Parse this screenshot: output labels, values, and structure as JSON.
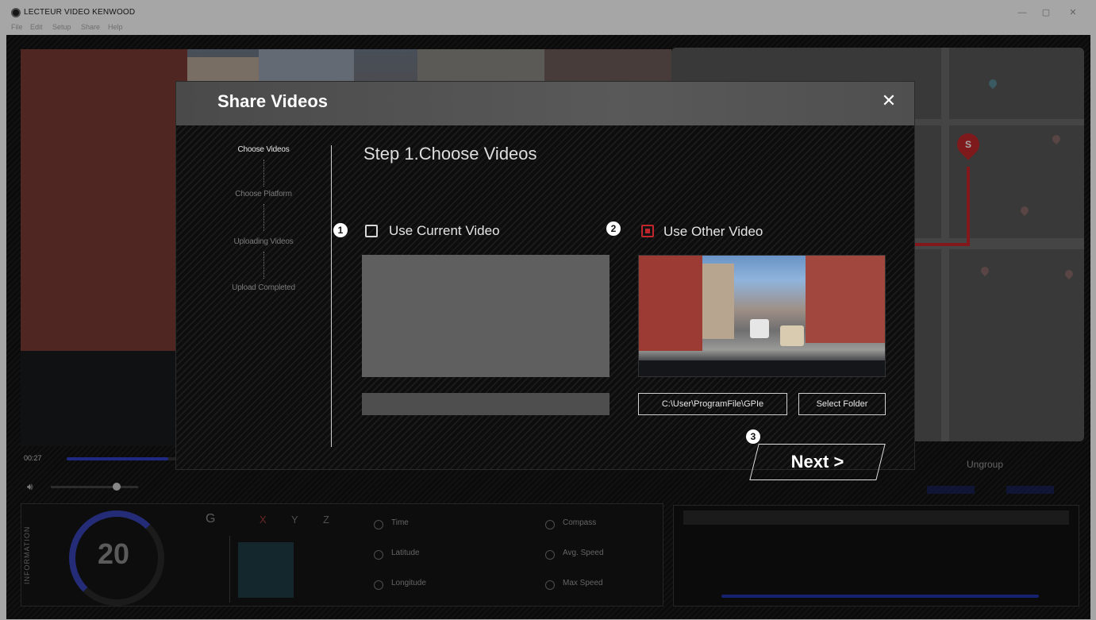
{
  "window": {
    "title": "LECTEUR VIDEO KENWOOD",
    "menu": [
      "File",
      "Edit",
      "Setup",
      "Share",
      "Help"
    ],
    "controls": {
      "minimize": "—",
      "maximize": "▢",
      "close": "✕"
    }
  },
  "player": {
    "time": "00:27",
    "progress": 0.85,
    "volume": 0.75,
    "ungroup_label": "Ungroup"
  },
  "info": {
    "panel_label": "INFORMATION",
    "speed": "20",
    "g_label": "G",
    "axes": [
      "X",
      "Y",
      "Z"
    ],
    "fields": {
      "time": "Time",
      "latitude": "Latitude",
      "longitude": "Longitude",
      "compass": "Compass",
      "avg_speed": "Avg. Speed",
      "max_speed": "Max Speed"
    }
  },
  "map": {
    "marker_label": "S"
  },
  "dialog": {
    "title": "Share Videos",
    "steps": [
      "Choose Videos",
      "Choose Platform",
      "Uploading Videos",
      "Upload Completed"
    ],
    "active_step": 0,
    "step_heading": "Step 1.Choose Videos",
    "option1": {
      "badge": "1",
      "label": "Use Current Video",
      "checked": false
    },
    "option2": {
      "badge": "2",
      "label": "Use Other Video",
      "checked": true
    },
    "path_value": "C:\\User\\ProgramFile\\GPIe",
    "select_folder": "Select Folder",
    "next_badge": "3",
    "next_label": "Next >",
    "close_icon": "✕"
  },
  "colors": {
    "accent_red": "#c0272d",
    "accent_blue": "#3140c8",
    "header_gray": "#555555"
  }
}
